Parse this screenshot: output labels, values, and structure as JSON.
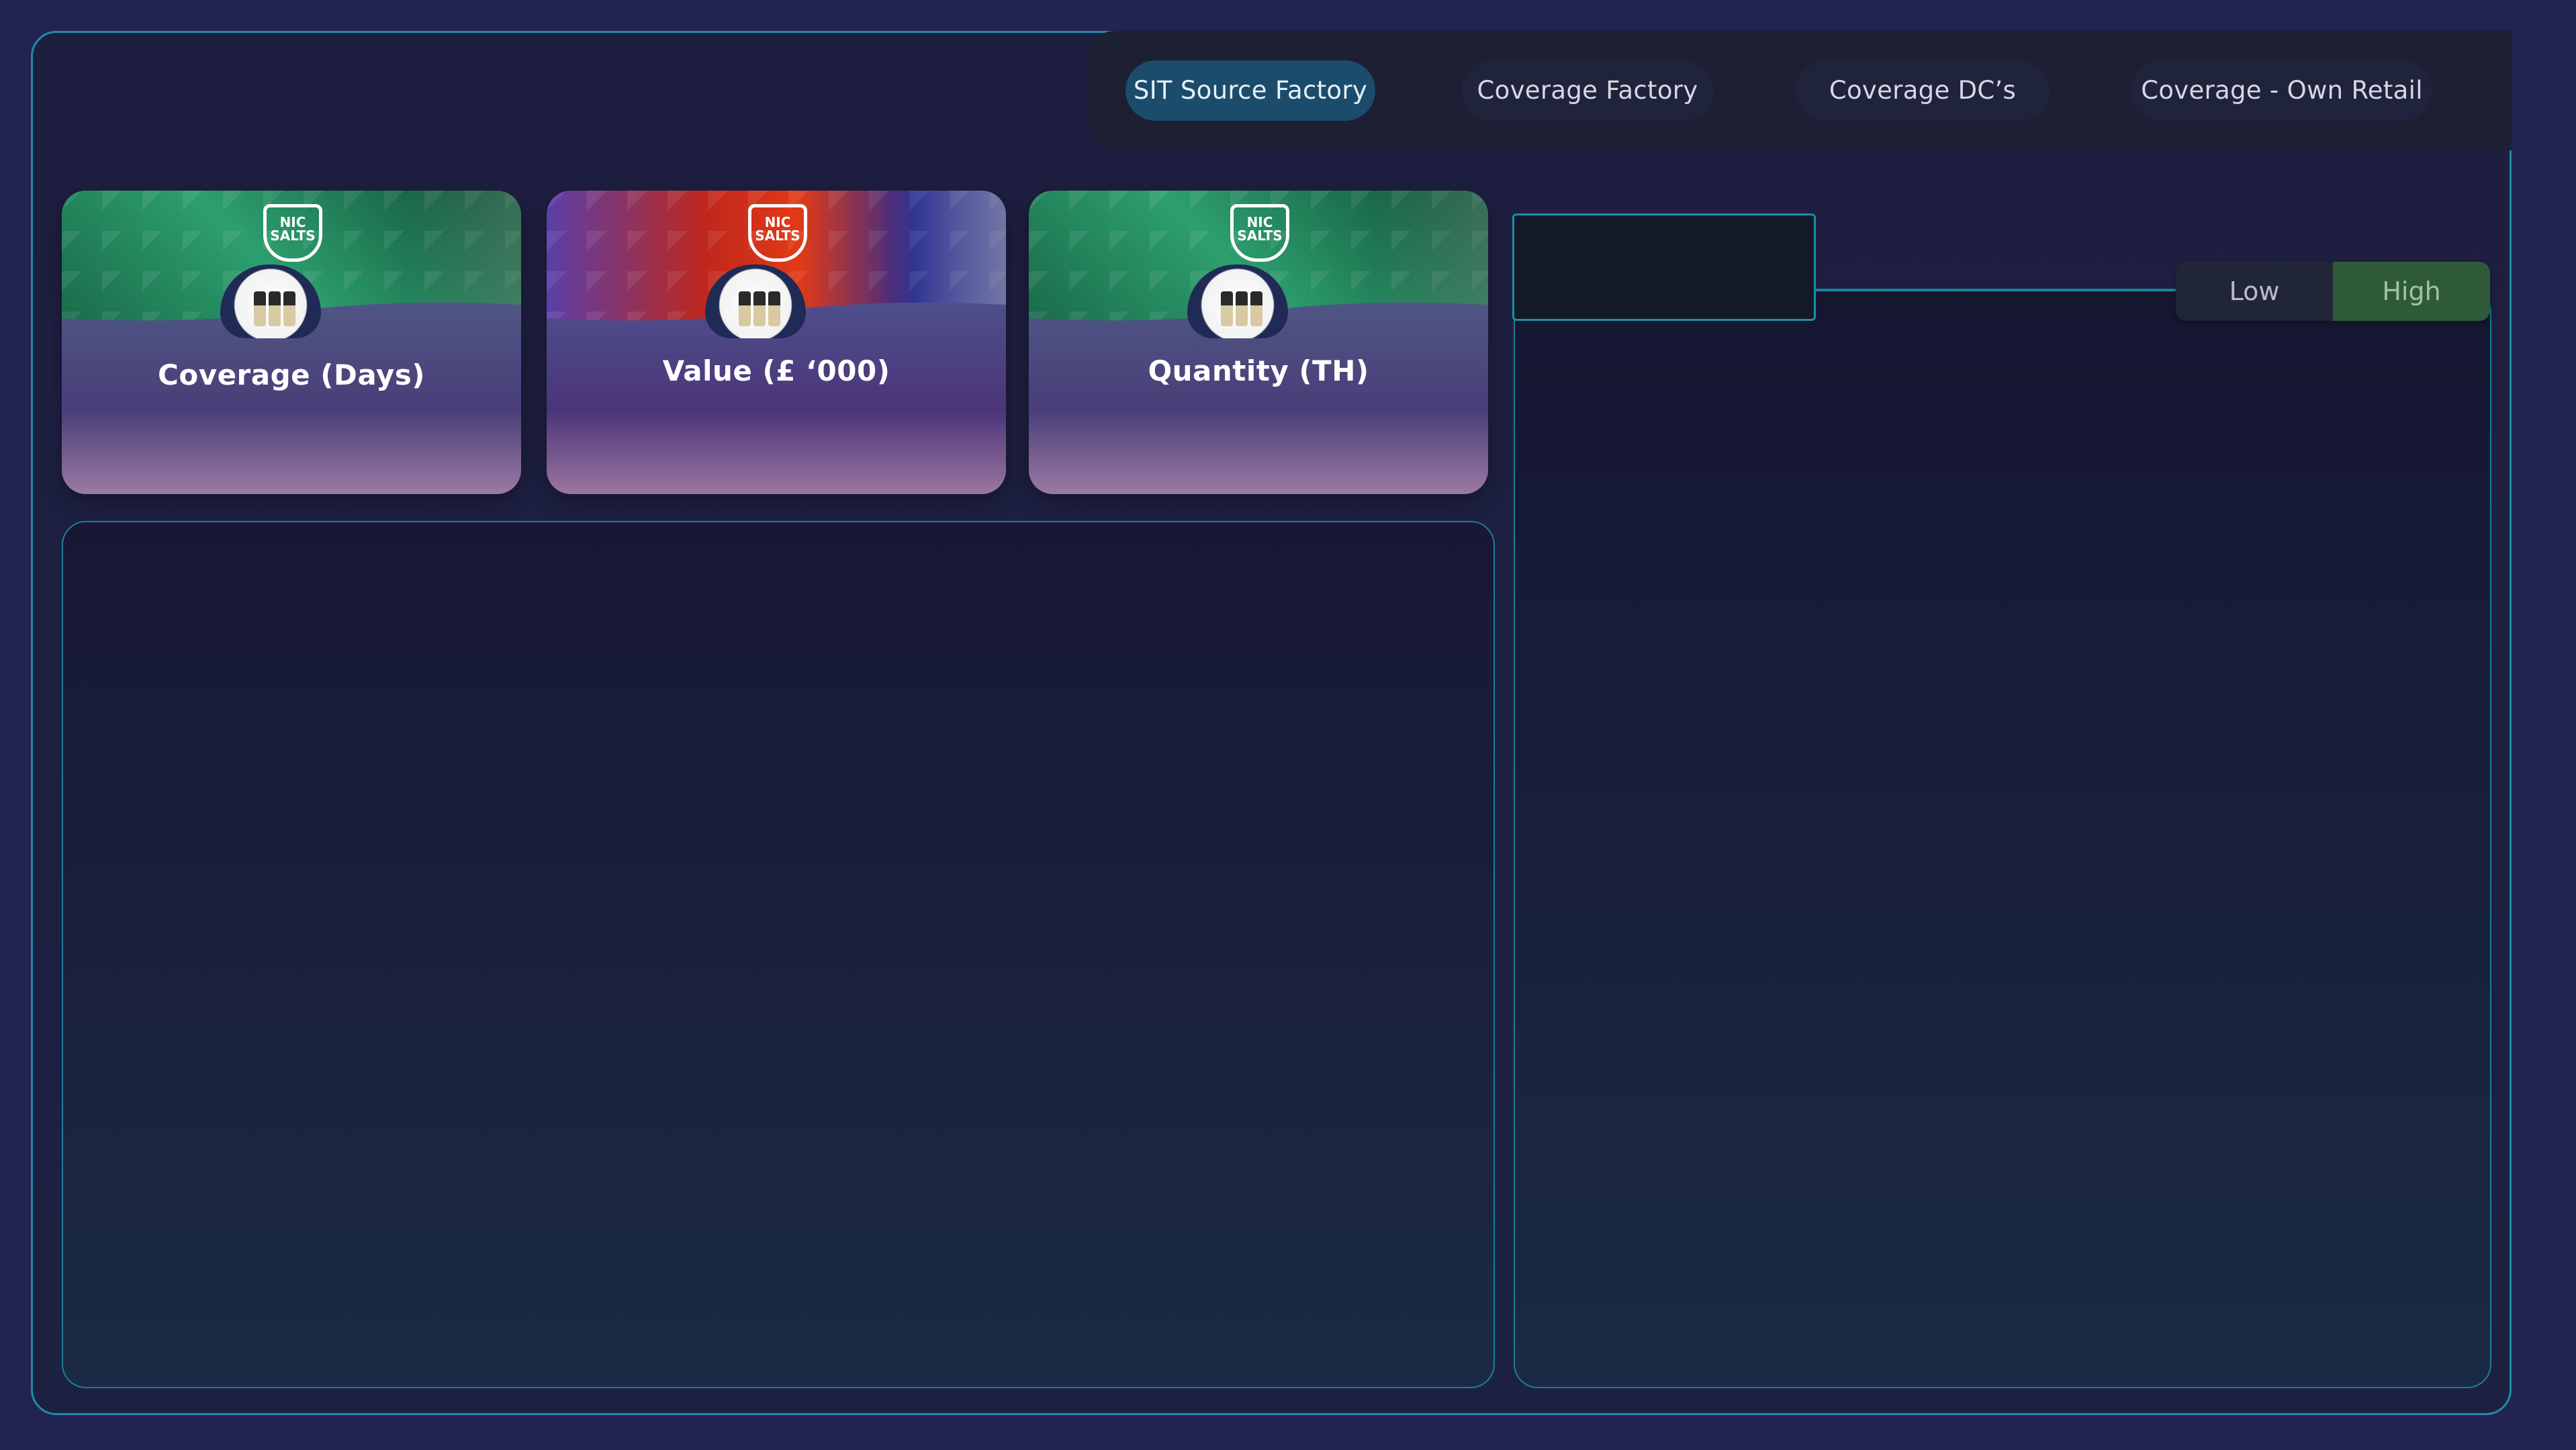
{
  "tabs": [
    {
      "label": "SIT Source Factory",
      "active": true
    },
    {
      "label": "Coverage Factory",
      "active": false
    },
    {
      "label": "Coverage DC’s",
      "active": false
    },
    {
      "label": "Coverage - Own Retail",
      "active": false
    }
  ],
  "cards": [
    {
      "label": "Coverage (Days)",
      "theme": "green",
      "badge": "NIC SALTS"
    },
    {
      "label": "Value (£ ‘000)",
      "theme": "red",
      "badge": "NIC SALTS"
    },
    {
      "label": "Quantity (TH)",
      "theme": "green",
      "badge": "NIC SALTS"
    }
  ],
  "toggle": {
    "low_label": "Low",
    "high_label": "High",
    "selected": "High"
  },
  "colors": {
    "accent": "#1d8ea5",
    "active_tab": "#1c4c6c",
    "toggle_selected": "#2f5a3a",
    "background": "#222350"
  }
}
